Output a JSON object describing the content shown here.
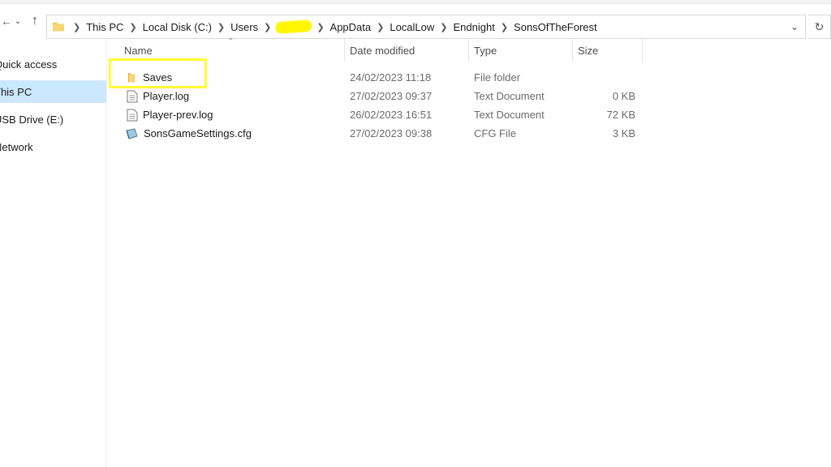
{
  "window": {
    "path": [
      {
        "label": "This PC"
      },
      {
        "label": "Local Disk (C:)"
      },
      {
        "label": "Users"
      },
      {
        "label": "",
        "redacted": true
      },
      {
        "label": "AppData"
      },
      {
        "label": "LocalLow"
      },
      {
        "label": "Endnight"
      },
      {
        "label": "SonsOfTheForest"
      }
    ]
  },
  "sidebar": {
    "items": [
      {
        "label": "Quick access",
        "selected": false
      },
      {
        "label": "This PC",
        "selected": true
      },
      {
        "label": "USB Drive (E:)",
        "selected": false
      },
      {
        "label": "Network",
        "selected": false
      }
    ]
  },
  "columns": {
    "name": "Name",
    "date": "Date modified",
    "type": "Type",
    "size": "Size"
  },
  "files": [
    {
      "name": "Saves",
      "date": "24/02/2023 11:18",
      "type": "File folder",
      "size": "",
      "icon": "folder-icon"
    },
    {
      "name": "Player.log",
      "date": "27/02/2023 09:37",
      "type": "Text Document",
      "size": "0 KB",
      "icon": "text-file-icon"
    },
    {
      "name": "Player-prev.log",
      "date": "26/02/2023 16:51",
      "type": "Text Document",
      "size": "72 KB",
      "icon": "text-file-icon"
    },
    {
      "name": "SonsGameSettings.cfg",
      "date": "27/02/2023 09:38",
      "type": "CFG File",
      "size": "3 KB",
      "icon": "cfg-file-icon"
    }
  ],
  "colors": {
    "selection": "#cce8ff",
    "highlight": "#ffff33",
    "folder": "#f4c64f"
  }
}
